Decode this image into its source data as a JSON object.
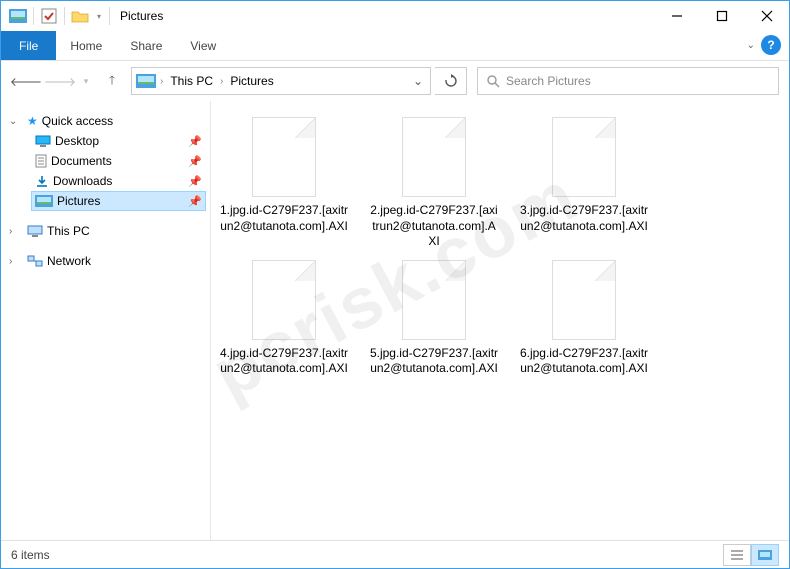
{
  "window": {
    "title": "Pictures",
    "min_tip": "Minimize",
    "max_tip": "Maximize",
    "close_tip": "Close"
  },
  "ribbon": {
    "file": "File",
    "tabs": [
      "Home",
      "Share",
      "View"
    ]
  },
  "breadcrumb": {
    "segments": [
      "This PC",
      "Pictures"
    ]
  },
  "search": {
    "placeholder": "Search Pictures"
  },
  "tree": {
    "quick_access": "Quick access",
    "items": [
      {
        "label": "Desktop",
        "pinned": true
      },
      {
        "label": "Documents",
        "pinned": true
      },
      {
        "label": "Downloads",
        "pinned": true
      },
      {
        "label": "Pictures",
        "pinned": true,
        "selected": true
      }
    ],
    "this_pc": "This PC",
    "network": "Network"
  },
  "files": [
    "1.jpg.id-C279F237.[axitrun2@tutanota.com].AXI",
    "2.jpeg.id-C279F237.[axitrun2@tutanota.com].AXI",
    "3.jpg.id-C279F237.[axitrun2@tutanota.com].AXI",
    "4.jpg.id-C279F237.[axitrun2@tutanota.com].AXI",
    "5.jpg.id-C279F237.[axitrun2@tutanota.com].AXI",
    "6.jpg.id-C279F237.[axitrun2@tutanota.com].AXI"
  ],
  "status": {
    "count_label": "6 items"
  },
  "watermark": "pcrisk.com"
}
